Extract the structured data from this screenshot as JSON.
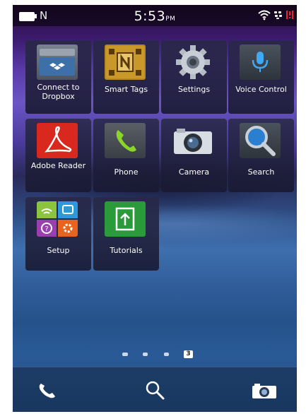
{
  "status_bar": {
    "time": "5:53",
    "time_suffix": "PM",
    "nfc_glyph": "N",
    "icons": [
      "battery-icon",
      "wifi-icon",
      "bbm-icon",
      "notification-icon"
    ]
  },
  "apps": [
    {
      "label": "Connect to Dropbox",
      "icon": "dropbox-icon"
    },
    {
      "label": "Smart Tags",
      "icon": "smart-tags-icon"
    },
    {
      "label": "Settings",
      "icon": "gear-icon"
    },
    {
      "label": "Voice Control",
      "icon": "microphone-icon"
    },
    {
      "label": "Adobe Reader",
      "icon": "adobe-reader-icon"
    },
    {
      "label": "Phone",
      "icon": "phone-icon"
    },
    {
      "label": "Camera",
      "icon": "camera-icon"
    },
    {
      "label": "Search",
      "icon": "search-icon"
    },
    {
      "label": "Setup",
      "icon": "setup-icon"
    },
    {
      "label": "Tutorials",
      "icon": "tutorials-icon"
    }
  ],
  "page_indicator": {
    "current": "3",
    "total": 4
  },
  "dock": [
    "phone-icon",
    "search-icon",
    "camera-icon"
  ],
  "colors": {
    "accent_red": "#d9281e",
    "green": "#2a9a3a"
  }
}
